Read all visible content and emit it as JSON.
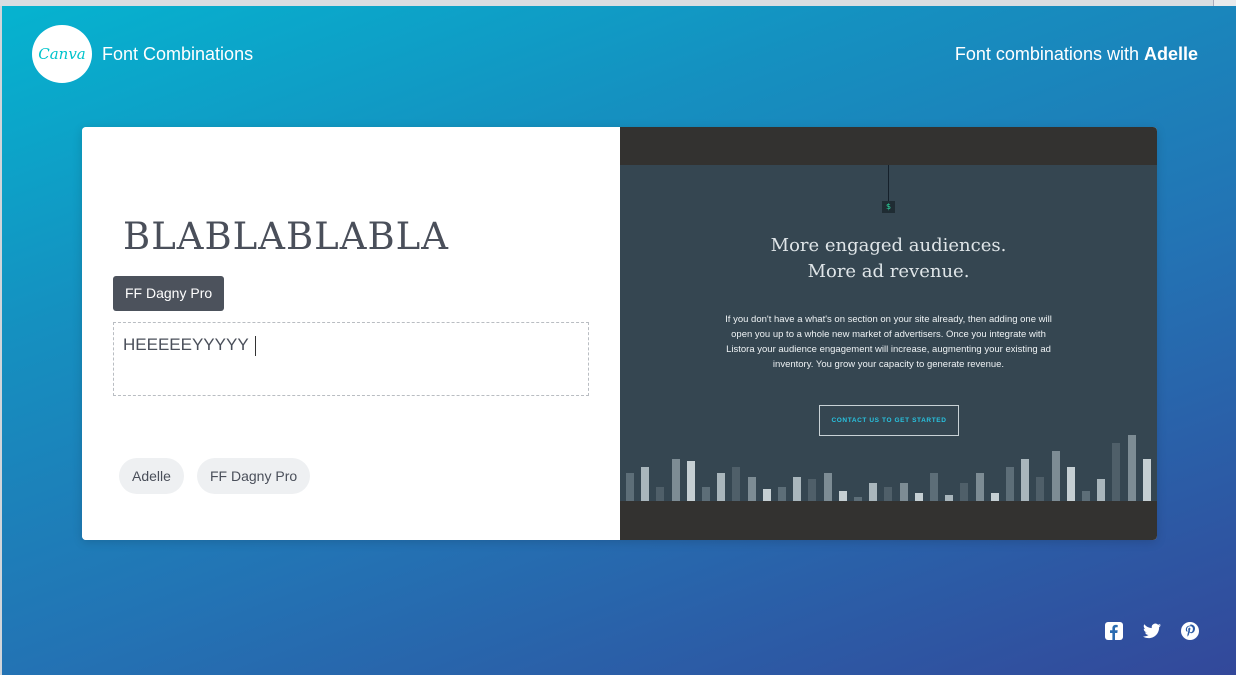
{
  "header": {
    "logo_text": "Canva",
    "title": "Font Combinations",
    "right_prefix": "Font combinations with ",
    "right_font": "Adelle"
  },
  "editor": {
    "headline": "BLABLABLABLA",
    "body_font_tag": "FF Dagny Pro",
    "body_text": "HEEEEEYYYYY",
    "pills": [
      "Adelle",
      "FF Dagny Pro"
    ]
  },
  "preview": {
    "icon": "$",
    "title_line1": "More engaged audiences.",
    "title_line2": "More ad revenue.",
    "body": "If you don't have a what's on section on your site already, then adding one will open you up to a whole new market of advertisers. Once you integrate with Listora your audience engagement will increase, augmenting your existing ad inventory. You grow your capacity to generate revenue.",
    "button": "CONTACT US TO GET STARTED",
    "skyline_heights": [
      28,
      34,
      14,
      42,
      40,
      14,
      28,
      34,
      24,
      12,
      14,
      24,
      22,
      28,
      10,
      4,
      18,
      14,
      18,
      8,
      28,
      6,
      18,
      28,
      8,
      34,
      42,
      24,
      50,
      34,
      10,
      22,
      58,
      66,
      42
    ]
  },
  "social": [
    "facebook-icon",
    "twitter-icon",
    "pinterest-icon"
  ],
  "colors": {
    "accent": "#00c4cc",
    "tag_bg": "#4c525c",
    "preview_bg": "#354651",
    "button_text": "#28c3e0"
  }
}
